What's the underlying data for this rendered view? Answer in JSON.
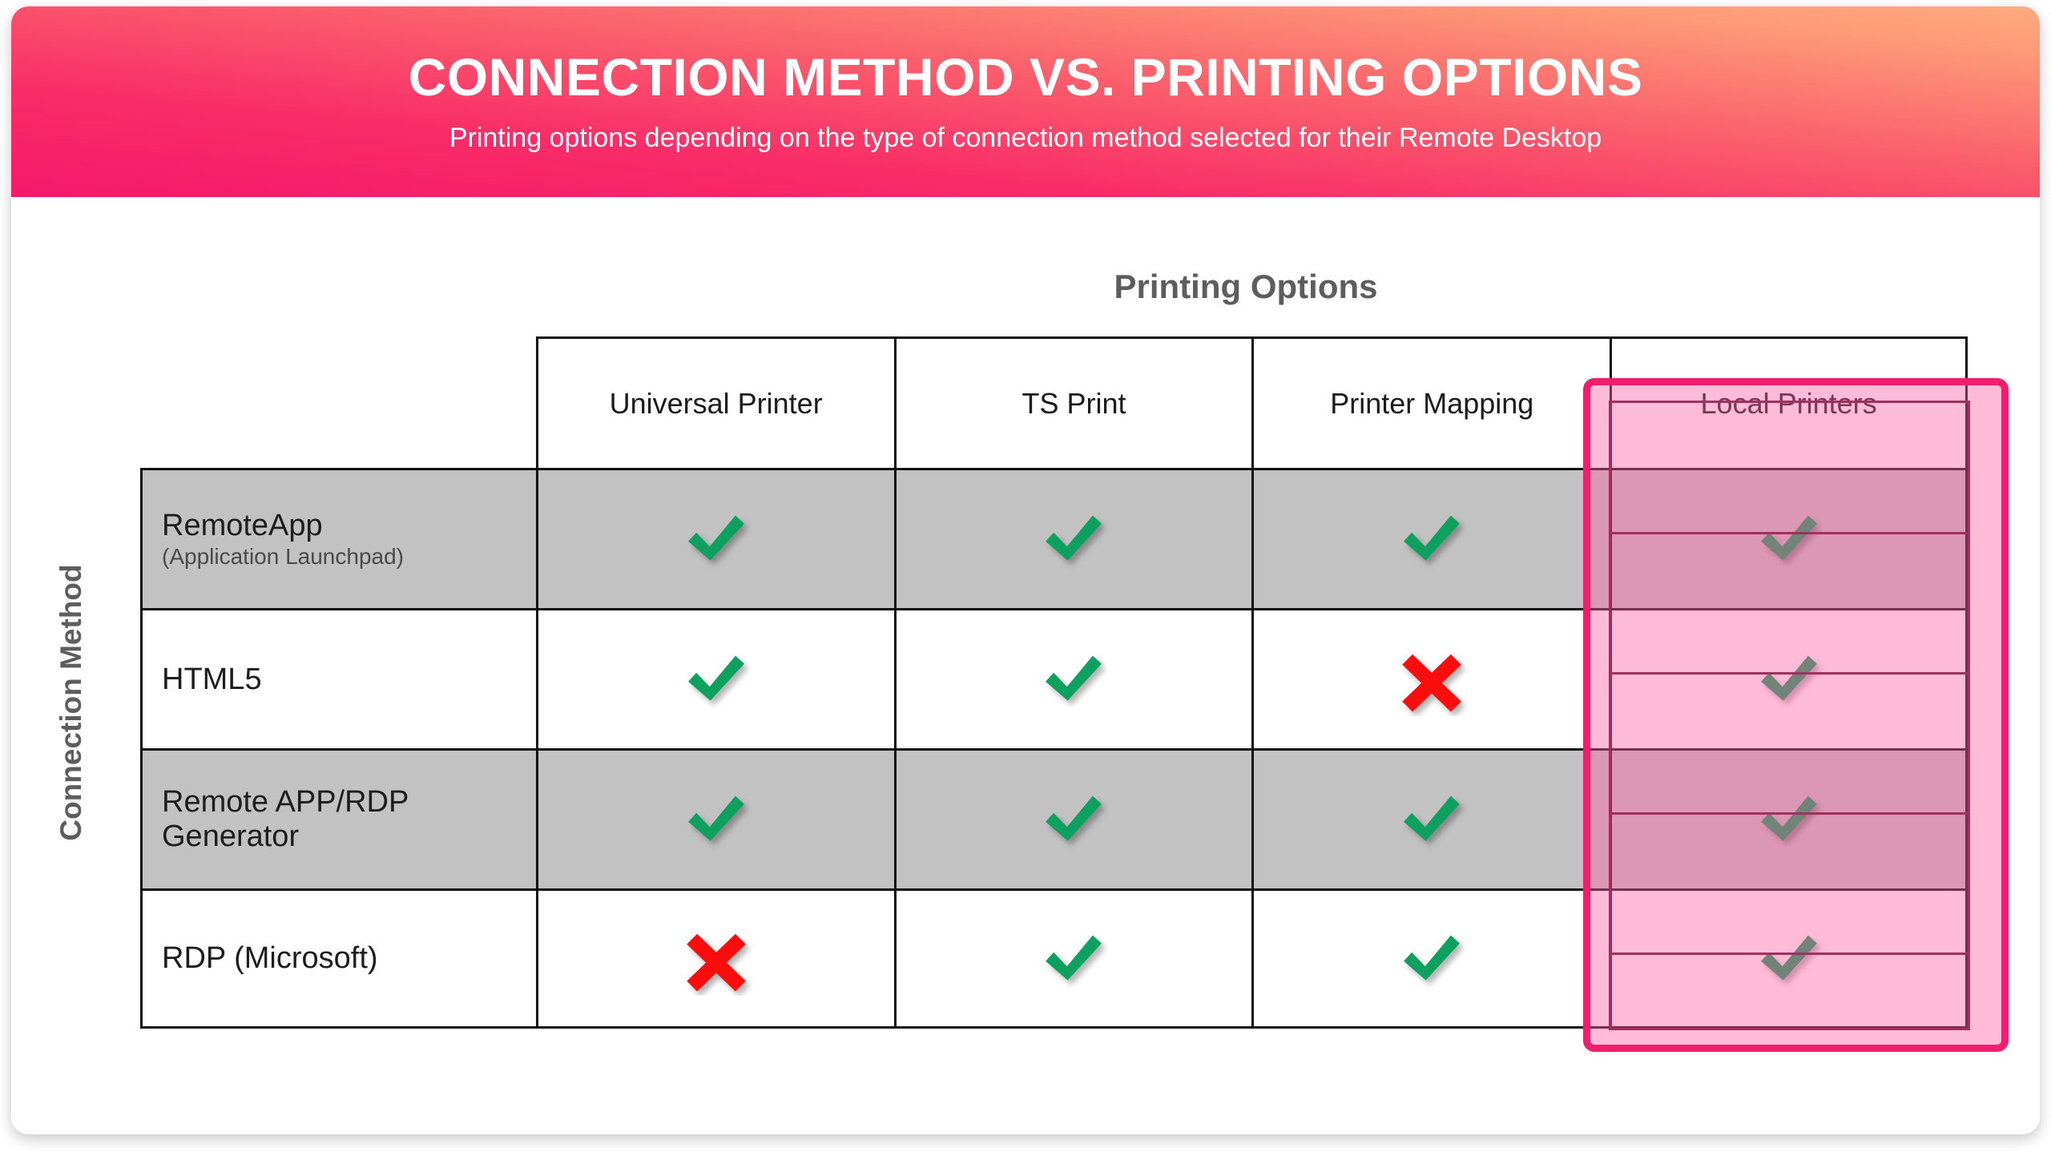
{
  "header": {
    "title": "CONNECTION METHOD VS. PRINTING OPTIONS",
    "subtitle": "Printing options depending on the type of connection method selected for their Remote Desktop",
    "gradient_start": "#f5196b",
    "gradient_end": "#ffab80"
  },
  "axis": {
    "column_axis_title": "Printing Options",
    "row_axis_title": "Connection Method"
  },
  "colors": {
    "check": "#10a05e",
    "cross": "#fc1111",
    "shaded_row": "#c2c2c2",
    "highlight_border": "#f01f6e",
    "highlight_fill": "rgba(255, 92, 160, 0.42)",
    "grid_line": "#111111",
    "axis_text": "#5d5d5d"
  },
  "marks": {
    "check_name": "check-mark-icon",
    "cross_name": "cross-mark-icon",
    "check_label": "Supported",
    "cross_label": "Not supported"
  },
  "chart_data": {
    "type": "table",
    "title": "CONNECTION METHOD VS. PRINTING OPTIONS",
    "subtitle": "Printing options depending on the type of connection method selected for their Remote Desktop",
    "xlabel": "Printing Options",
    "ylabel": "Connection Method",
    "highlighted_column": "Local Printers",
    "columns": [
      {
        "label": "Universal Printer",
        "highlighted": false
      },
      {
        "label": "TS Print",
        "highlighted": false
      },
      {
        "label": "Printer Mapping",
        "highlighted": false
      },
      {
        "label": "Local Printers",
        "highlighted": true
      }
    ],
    "rows": [
      {
        "label": "RemoteApp",
        "sublabel": "(Application Launchpad)",
        "shaded": true,
        "values": [
          "check",
          "check",
          "check",
          "check"
        ]
      },
      {
        "label": "HTML5",
        "sublabel": "",
        "shaded": false,
        "values": [
          "check",
          "check",
          "cross",
          "check"
        ]
      },
      {
        "label": "Remote APP/RDP Generator",
        "sublabel": "",
        "shaded": true,
        "values": [
          "check",
          "check",
          "check",
          "check"
        ]
      },
      {
        "label": "RDP (Microsoft)",
        "sublabel": "",
        "shaded": false,
        "values": [
          "cross",
          "check",
          "check",
          "check"
        ]
      }
    ]
  }
}
